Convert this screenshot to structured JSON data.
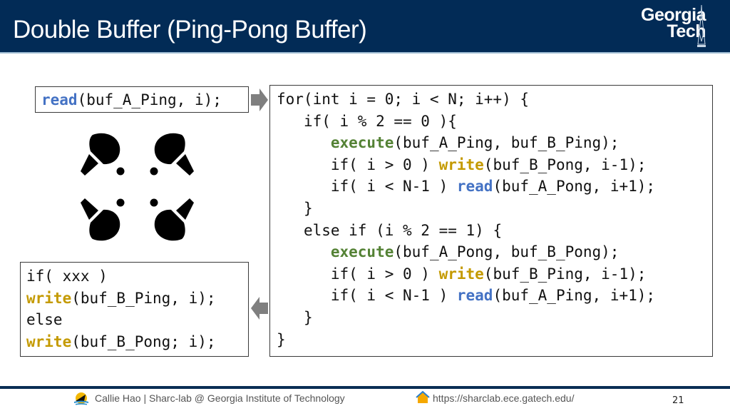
{
  "slide": {
    "title": "Double Buffer (Ping-Pong Buffer)",
    "logo": {
      "line1": "Georgia",
      "line2": "Tech"
    },
    "read_box": {
      "fn": "read",
      "rest": "(buf_A_Ping, i);"
    },
    "loop_box": {
      "lines": [
        {
          "indent": "",
          "pre": "for(int i = 0; i < N; i++) {",
          "fn": "",
          "fn_type": "",
          "post": ""
        },
        {
          "indent": "   ",
          "pre": "if( i % 2 == 0 ){",
          "fn": "",
          "fn_type": "",
          "post": ""
        },
        {
          "indent": "      ",
          "pre": "",
          "fn": "execute",
          "fn_type": "exec",
          "post": "(buf_A_Ping, buf_B_Ping);"
        },
        {
          "indent": "      ",
          "pre": "if( i > 0 ) ",
          "fn": "write",
          "fn_type": "write",
          "post": "(buf_B_Pong, i-1);"
        },
        {
          "indent": "      ",
          "pre": "if( i < N-1 ) ",
          "fn": "read",
          "fn_type": "read",
          "post": "(buf_A_Pong, i+1);"
        },
        {
          "indent": "   ",
          "pre": "}",
          "fn": "",
          "fn_type": "",
          "post": ""
        },
        {
          "indent": "   ",
          "pre": "else if (i % 2 == 1) {",
          "fn": "",
          "fn_type": "",
          "post": ""
        },
        {
          "indent": "      ",
          "pre": "",
          "fn": "execute",
          "fn_type": "exec",
          "post": "(buf_A_Pong, buf_B_Pong);"
        },
        {
          "indent": "      ",
          "pre": "if( i > 0 ) ",
          "fn": "write",
          "fn_type": "write",
          "post": "(buf_B_Ping, i-1);"
        },
        {
          "indent": "      ",
          "pre": "if( i < N-1 ) ",
          "fn": "read",
          "fn_type": "read",
          "post": "(buf_A_Ping, i+1);"
        },
        {
          "indent": "   ",
          "pre": "}",
          "fn": "",
          "fn_type": "",
          "post": ""
        },
        {
          "indent": "",
          "pre": "}",
          "fn": "",
          "fn_type": "",
          "post": ""
        }
      ]
    },
    "write_box": {
      "line1": "if( xxx )",
      "line2_fn": "write",
      "line2_rest": "(buf_B_Ping, i);",
      "line3": "else",
      "line4_fn": "write",
      "line4_rest": "(buf_B_Pong; i);"
    },
    "icons": {
      "paddles": "ping-pong-paddles-icon",
      "arrow_right": "arrow-right-icon",
      "arrow_left": "arrow-left-icon"
    }
  },
  "footer": {
    "credit": "Callie Hao | Sharc-lab @ Georgia Institute of Technology",
    "url": "https://sharclab.ece.gatech.edu/",
    "page_number": "21"
  },
  "colors": {
    "header": "#022b56",
    "read": "#4472c4",
    "write": "#c49a00",
    "execute": "#548235",
    "arrow": "#7f7f7f"
  }
}
